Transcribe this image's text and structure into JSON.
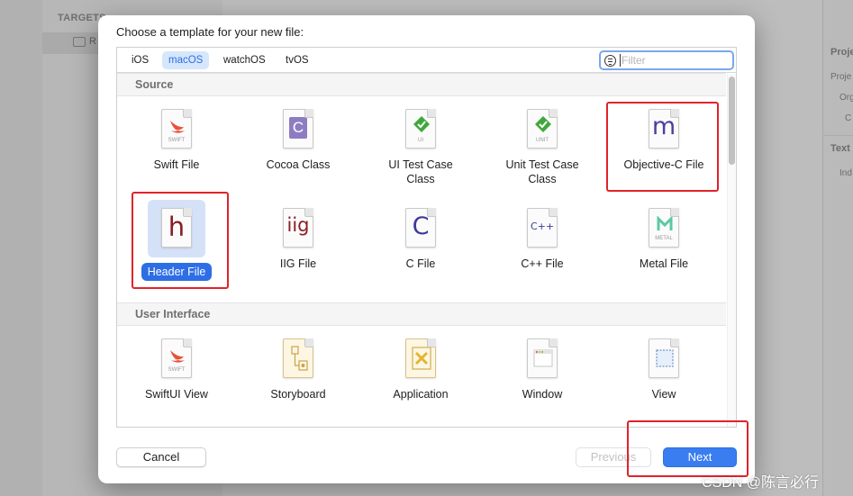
{
  "background": {
    "sidebar_section": "TARGETS",
    "sidebar_item": "R",
    "inspector_sections": [
      "Proje",
      "Text"
    ],
    "inspector_labels": [
      "Proje",
      "Org",
      "C",
      "Ind"
    ]
  },
  "dialog": {
    "title": "Choose a template for your new file:",
    "platform_tabs": [
      "iOS",
      "macOS",
      "watchOS",
      "tvOS"
    ],
    "active_platform": "macOS",
    "filter_placeholder": "Filter",
    "sections": [
      {
        "title": "Source",
        "templates": [
          {
            "label": "Swift File",
            "icon": "swift-file-icon",
            "glyph": "SWIFT"
          },
          {
            "label": "Cocoa Class",
            "icon": "cocoa-class-icon",
            "glyph": "C"
          },
          {
            "label": "UI Test Case Class",
            "label_lines": [
              "UI Test Case",
              "Class"
            ],
            "icon": "ui-test-case-icon",
            "glyph": "UI"
          },
          {
            "label": "Unit Test Case Class",
            "label_lines": [
              "Unit Test Case",
              "Class"
            ],
            "icon": "unit-test-case-icon",
            "glyph": "UNIT"
          },
          {
            "label": "Objective-C File",
            "icon": "objective-c-file-icon",
            "glyph": "m"
          },
          {
            "label": "Header File",
            "icon": "header-file-icon",
            "glyph": "h",
            "selected": true
          },
          {
            "label": "IIG File",
            "icon": "iig-file-icon",
            "glyph": "iig"
          },
          {
            "label": "C File",
            "icon": "c-file-icon",
            "glyph": "C"
          },
          {
            "label": "C++ File",
            "icon": "cpp-file-icon",
            "glyph": "C++"
          },
          {
            "label": "Metal File",
            "icon": "metal-file-icon",
            "glyph": "METAL"
          }
        ]
      },
      {
        "title": "User Interface",
        "templates": [
          {
            "label": "SwiftUI View",
            "icon": "swiftui-view-icon",
            "glyph": "SWIFT"
          },
          {
            "label": "Storyboard",
            "icon": "storyboard-icon"
          },
          {
            "label": "Application",
            "icon": "application-icon"
          },
          {
            "label": "Window",
            "icon": "window-icon"
          },
          {
            "label": "View",
            "icon": "view-icon"
          }
        ]
      }
    ],
    "buttons": {
      "cancel": "Cancel",
      "previous": "Previous",
      "next": "Next"
    }
  },
  "colors": {
    "accent": "#2d6ee6",
    "annotation": "#e0232a",
    "selection_bg": "#d5e1f7"
  },
  "watermark": "CSDN @陈言必行"
}
